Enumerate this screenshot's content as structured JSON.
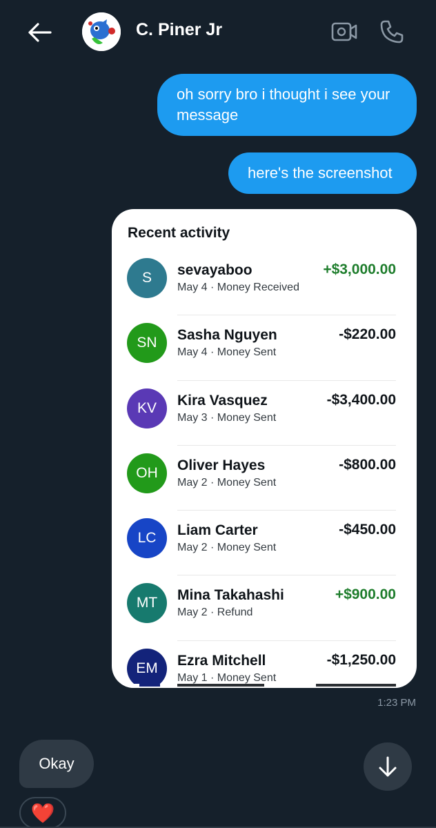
{
  "header": {
    "contact_name": "C. Piner Jr",
    "back_icon": "arrow-left-icon",
    "video_icon": "video-camera-icon",
    "call_icon": "phone-icon"
  },
  "messages": {
    "outgoing_1": "oh sorry bro i thought i see your message",
    "outgoing_2": "here's the screenshot",
    "timestamp": "1:23 PM",
    "incoming_1": "Okay",
    "reaction": "❤️"
  },
  "screenshot": {
    "title": "Recent activity",
    "rows": [
      {
        "initials": "S",
        "name": "sevayaboo",
        "meta": "May 4 · Money Received",
        "amount": "+$3,000.00",
        "positive": true,
        "color": "#2e7a8f"
      },
      {
        "initials": "SN",
        "name": "Sasha Nguyen",
        "meta": "May 4 · Money Sent",
        "amount": "-$220.00",
        "positive": false,
        "color": "#229a1a"
      },
      {
        "initials": "KV",
        "name": "Kira Vasquez",
        "meta": "May 3 · Money Sent",
        "amount": "-$3,400.00",
        "positive": false,
        "color": "#5a39b5"
      },
      {
        "initials": "OH",
        "name": "Oliver Hayes",
        "meta": "May 2 · Money Sent",
        "amount": "-$800.00",
        "positive": false,
        "color": "#229a1a"
      },
      {
        "initials": "LC",
        "name": "Liam Carter",
        "meta": "May 2 · Money Sent",
        "amount": "-$450.00",
        "positive": false,
        "color": "#1745c6"
      },
      {
        "initials": "MT",
        "name": "Mina Takahashi",
        "meta": "May 2 · Refund",
        "amount": "+$900.00",
        "positive": true,
        "color": "#177a6e"
      },
      {
        "initials": "EM",
        "name": "Ezra Mitchell",
        "meta": "May 1 · Money Sent",
        "amount": "-$1,250.00",
        "positive": false,
        "color": "#13237a"
      }
    ]
  },
  "colors": {
    "background": "#15202b",
    "bubble_out": "#1d9bf0",
    "bubble_in": "#2f3a45",
    "positive_amount": "#1e7d2c"
  },
  "scroll_icon": "arrow-down-icon"
}
